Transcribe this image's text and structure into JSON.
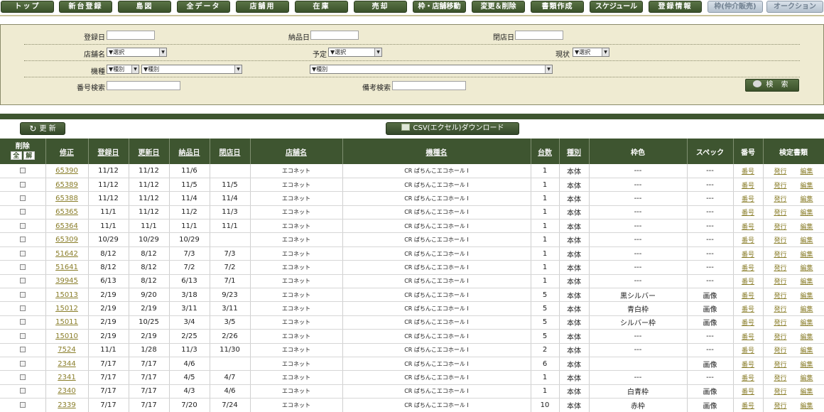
{
  "nav": {
    "items": [
      {
        "label": "トップ"
      },
      {
        "label": "新台登録"
      },
      {
        "label": "島図"
      },
      {
        "label": "全データ"
      },
      {
        "label": "店舗用"
      },
      {
        "label": "在庫"
      },
      {
        "label": "売却"
      },
      {
        "label": "枠・店舗移動"
      },
      {
        "label": "変更＆削除"
      },
      {
        "label": "書類作成"
      },
      {
        "label": "スケジュール"
      },
      {
        "label": "登録情報"
      },
      {
        "label": "枠(仲介販売)"
      },
      {
        "label": "オークション"
      }
    ]
  },
  "search": {
    "registered_date_label": "登録日",
    "delivery_date_label": "納品日",
    "closing_date_label": "閉店日",
    "store_label": "店舗名",
    "store_value": "▼選択",
    "plan_label": "予定",
    "plan_value": "▼選択",
    "status_label": "現状",
    "status_value": "▼選択",
    "model_label": "機種",
    "model_kind1": "▼種別",
    "model_kind2": "▼種別",
    "model_kind3": "▼種別",
    "number_search_label": "番号検索",
    "note_search_label": "備考検索",
    "search_button": "検 索"
  },
  "toolbar": {
    "refresh_label": "更 新",
    "csv_label": "CSV(エクセル)ダウンロード"
  },
  "table": {
    "headers": {
      "delete": "削除",
      "delete_all": "全",
      "delete_clear": "解",
      "edit": "修正",
      "registered": "登録日",
      "updated": "更新日",
      "delivered": "納品日",
      "closed": "閉店日",
      "store": "店舗名",
      "model": "機種名",
      "count": "台数",
      "kind": "種別",
      "frame_color": "枠色",
      "spec": "スペック",
      "number": "番号",
      "docs": "検定書類"
    },
    "link_number": "番号",
    "link_issue": "発行",
    "link_edit": "編集",
    "rows": [
      {
        "id": "65390",
        "reg": "11/12",
        "upd": "11/12",
        "dlv": "11/6",
        "cls": "",
        "store": "エコネット",
        "model": "CR ぱちんこエコホール I",
        "count": "1",
        "kind": "本体",
        "frame": "---",
        "spec": "---"
      },
      {
        "id": "65389",
        "reg": "11/12",
        "upd": "11/12",
        "dlv": "11/5",
        "cls": "11/5",
        "store": "エコネット",
        "model": "CR ぱちんこエコホール I",
        "count": "1",
        "kind": "本体",
        "frame": "---",
        "spec": "---"
      },
      {
        "id": "65388",
        "reg": "11/12",
        "upd": "11/12",
        "dlv": "11/4",
        "cls": "11/4",
        "store": "エコネット",
        "model": "CR ぱちんこエコホール I",
        "count": "1",
        "kind": "本体",
        "frame": "---",
        "spec": "---"
      },
      {
        "id": "65365",
        "reg": "11/1",
        "upd": "11/12",
        "dlv": "11/2",
        "cls": "11/3",
        "store": "エコネット",
        "model": "CR ぱちんこエコホール I",
        "count": "1",
        "kind": "本体",
        "frame": "---",
        "spec": "---"
      },
      {
        "id": "65364",
        "reg": "11/1",
        "upd": "11/1",
        "dlv": "11/1",
        "cls": "11/1",
        "store": "エコネット",
        "model": "CR ぱちんこエコホール I",
        "count": "1",
        "kind": "本体",
        "frame": "---",
        "spec": "---"
      },
      {
        "id": "65309",
        "reg": "10/29",
        "upd": "10/29",
        "dlv": "10/29",
        "cls": "",
        "store": "エコネット",
        "model": "CR ぱちんこエコホール I",
        "count": "1",
        "kind": "本体",
        "frame": "---",
        "spec": "---"
      },
      {
        "id": "51642",
        "reg": "8/12",
        "upd": "8/12",
        "dlv": "7/3",
        "cls": "7/3",
        "store": "エコネット",
        "model": "CR ぱちんこエコホール I",
        "count": "1",
        "kind": "本体",
        "frame": "---",
        "spec": "---"
      },
      {
        "id": "51641",
        "reg": "8/12",
        "upd": "8/12",
        "dlv": "7/2",
        "cls": "7/2",
        "store": "エコネット",
        "model": "CR ぱちんこエコホール I",
        "count": "1",
        "kind": "本体",
        "frame": "---",
        "spec": "---"
      },
      {
        "id": "39945",
        "reg": "6/13",
        "upd": "8/12",
        "dlv": "6/13",
        "cls": "7/1",
        "store": "エコネット",
        "model": "CR ぱちんこエコホール I",
        "count": "1",
        "kind": "本体",
        "frame": "---",
        "spec": "---"
      },
      {
        "id": "15013",
        "reg": "2/19",
        "upd": "9/20",
        "dlv": "3/18",
        "cls": "9/23",
        "store": "エコネット",
        "model": "CR ぱちんこエコホール I",
        "count": "5",
        "kind": "本体",
        "frame": "黒シルバー",
        "spec": "画像"
      },
      {
        "id": "15012",
        "reg": "2/19",
        "upd": "2/19",
        "dlv": "3/11",
        "cls": "3/11",
        "store": "エコネット",
        "model": "CR ぱちんこエコホール I",
        "count": "5",
        "kind": "本体",
        "frame": "青白枠",
        "spec": "画像"
      },
      {
        "id": "15011",
        "reg": "2/19",
        "upd": "10/25",
        "dlv": "3/4",
        "cls": "3/5",
        "store": "エコネット",
        "model": "CR ぱちんこエコホール I",
        "count": "5",
        "kind": "本体",
        "frame": "シルバー枠",
        "spec": "画像"
      },
      {
        "id": "15010",
        "reg": "2/19",
        "upd": "2/19",
        "dlv": "2/25",
        "cls": "2/26",
        "store": "エコネット",
        "model": "CR ぱちんこエコホール I",
        "count": "5",
        "kind": "本体",
        "frame": "---",
        "spec": "---"
      },
      {
        "id": "7524",
        "reg": "11/1",
        "upd": "1/28",
        "dlv": "11/3",
        "cls": "11/30",
        "store": "エコネット",
        "model": "CR ぱちんこエコホール I",
        "count": "2",
        "kind": "本体",
        "frame": "---",
        "spec": "---"
      },
      {
        "id": "2344",
        "reg": "7/17",
        "upd": "7/17",
        "dlv": "4/6",
        "cls": "",
        "store": "エコネット",
        "model": "CR ぱちんこエコホール I",
        "count": "6",
        "kind": "本体",
        "frame": "",
        "spec": "画像"
      },
      {
        "id": "2341",
        "reg": "7/17",
        "upd": "7/17",
        "dlv": "4/5",
        "cls": "4/7",
        "store": "エコネット",
        "model": "CR ぱちんこエコホール I",
        "count": "1",
        "kind": "本体",
        "frame": "---",
        "spec": "---"
      },
      {
        "id": "2340",
        "reg": "7/17",
        "upd": "7/17",
        "dlv": "4/3",
        "cls": "4/6",
        "store": "エコネット",
        "model": "CR ぱちんこエコホール I",
        "count": "1",
        "kind": "本体",
        "frame": "白青枠",
        "spec": "画像"
      },
      {
        "id": "2339",
        "reg": "7/17",
        "upd": "7/17",
        "dlv": "7/20",
        "cls": "7/24",
        "store": "エコネット",
        "model": "CR ぱちんこエコホール I",
        "count": "10",
        "kind": "本体",
        "frame": "赤枠",
        "spec": "画像"
      }
    ]
  }
}
